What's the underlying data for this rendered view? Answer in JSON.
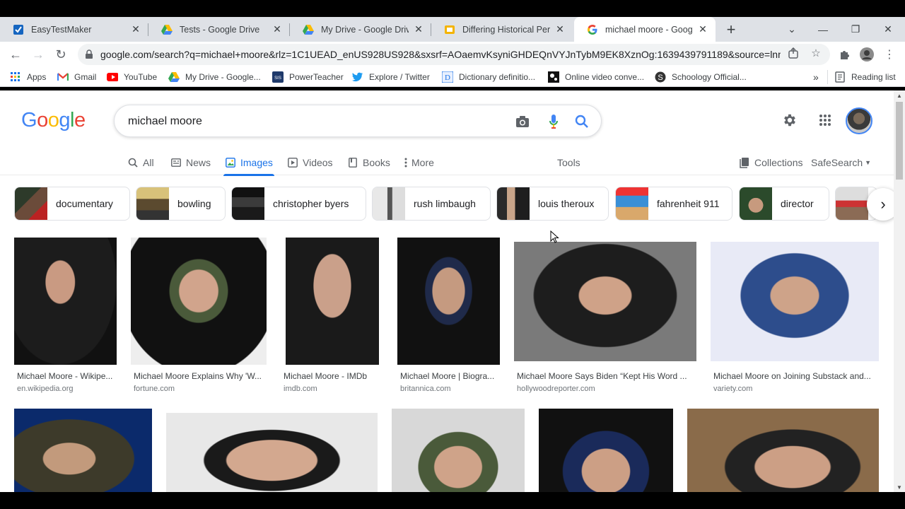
{
  "browser": {
    "tabs": [
      {
        "title": "EasyTestMaker",
        "icon": "easytestmaker-icon",
        "active": false
      },
      {
        "title": "Tests - Google Drive",
        "icon": "google-drive-icon",
        "active": false
      },
      {
        "title": "My Drive - Google Drive",
        "icon": "google-drive-icon",
        "active": false
      },
      {
        "title": "Differing Historical Perspe",
        "icon": "google-slides-icon",
        "active": false
      },
      {
        "title": "michael moore - Google I",
        "icon": "google-g-icon",
        "active": true
      }
    ],
    "url": "google.com/search?q=michael+moore&rlz=1C1UEAD_enUS928US928&sxsrf=AOaemvKsyniGHDEQnVYJnTybM9EK8XznOg:1639439791189&source=lnms...",
    "bookmarks": [
      {
        "label": "Apps",
        "icon": "apps-grid-icon"
      },
      {
        "label": "Gmail",
        "icon": "gmail-icon"
      },
      {
        "label": "YouTube",
        "icon": "youtube-icon"
      },
      {
        "label": "My Drive - Google...",
        "icon": "google-drive-icon"
      },
      {
        "label": "PowerTeacher",
        "icon": "powerteacher-icon"
      },
      {
        "label": "Explore / Twitter",
        "icon": "twitter-icon"
      },
      {
        "label": "Dictionary definitio...",
        "icon": "dictionary-icon"
      },
      {
        "label": "Online video conve...",
        "icon": "video-converter-icon"
      },
      {
        "label": "Schoology Official...",
        "icon": "schoology-icon"
      }
    ],
    "bookmarks_overflow": "»",
    "reading_list": "Reading list"
  },
  "google": {
    "logo": {
      "letters": [
        "G",
        "o",
        "o",
        "g",
        "l",
        "e"
      ],
      "colors": [
        "#4285f4",
        "#ea4335",
        "#fbbc05",
        "#4285f4",
        "#34a853",
        "#ea4335"
      ]
    },
    "query": "michael moore",
    "nav_tabs": [
      {
        "label": "All",
        "icon": "search-icon"
      },
      {
        "label": "News",
        "icon": "news-icon"
      },
      {
        "label": "Images",
        "icon": "images-icon",
        "active": true
      },
      {
        "label": "Videos",
        "icon": "videos-icon"
      },
      {
        "label": "Books",
        "icon": "books-icon"
      },
      {
        "label": "More",
        "icon": "more-vert-icon"
      }
    ],
    "tools": "Tools",
    "collections": "Collections",
    "safesearch": "SafeSearch",
    "chips": [
      {
        "label": "documentary"
      },
      {
        "label": "bowling"
      },
      {
        "label": "christopher byers"
      },
      {
        "label": "rush limbaugh"
      },
      {
        "label": "louis theroux"
      },
      {
        "label": "fahrenheit 911"
      },
      {
        "label": "director"
      }
    ],
    "results_row1": [
      {
        "title": "Michael Moore - Wikipe...",
        "source": "en.wikipedia.org"
      },
      {
        "title": "Michael Moore Explains Why 'W...",
        "source": "fortune.com"
      },
      {
        "title": "Michael Moore - IMDb",
        "source": "imdb.com"
      },
      {
        "title": "Michael Moore | Biogra...",
        "source": "britannica.com"
      },
      {
        "title": "Michael Moore Says Biden “Kept His Word ...",
        "source": "hollywoodreporter.com"
      },
      {
        "title": "Michael Moore on Joining Substack and...",
        "source": "variety.com"
      }
    ],
    "results_row2_count": 5
  },
  "colors": {
    "accent": "#1a73e8",
    "tabstrip": "#dee1e6"
  }
}
